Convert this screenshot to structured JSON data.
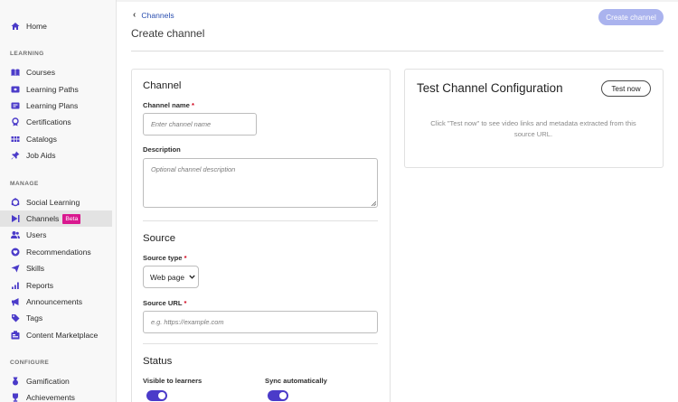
{
  "sidebar": {
    "home": "Home",
    "sections": {
      "learning": "LEARNING",
      "manage": "MANAGE",
      "configure": "CONFIGURE"
    },
    "learning_items": [
      "Courses",
      "Learning Paths",
      "Learning Plans",
      "Certifications",
      "Catalogs",
      "Job Aids"
    ],
    "manage_items": [
      "Social Learning",
      "Channels",
      "Users",
      "Recommendations",
      "Skills",
      "Reports",
      "Announcements",
      "Tags",
      "Content Marketplace"
    ],
    "configure_items": [
      "Gamification",
      "Achievements"
    ],
    "active_item": "Channels",
    "beta_badge": "Beta"
  },
  "header": {
    "back_label": "Channels",
    "title": "Create channel",
    "create_button": "Create channel"
  },
  "form": {
    "channel_section": "Channel",
    "channel_name_label": "Channel name",
    "channel_name_placeholder": "Enter channel name",
    "description_label": "Description",
    "description_placeholder": "Optional channel description",
    "source_section": "Source",
    "source_type_label": "Source type",
    "source_type_value": "Web page",
    "source_url_label": "Source URL",
    "source_url_placeholder": "e.g. https://example.com",
    "status_section": "Status",
    "visible_label": "Visible to learners",
    "visible_on": true,
    "sync_label": "Sync automatically",
    "sync_on": true,
    "required_mark": "*"
  },
  "test_panel": {
    "title": "Test Channel Configuration",
    "button": "Test now",
    "help": "Click \"Test now\" to see video links and metadata extracted from this source URL."
  },
  "colors": {
    "accent": "#4b3bc9",
    "primary_disabled": "#aab3ee",
    "beta": "#d9188f",
    "link": "#2b4fb0"
  }
}
